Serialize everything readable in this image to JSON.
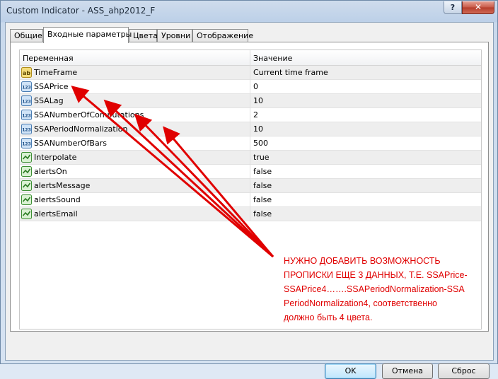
{
  "window": {
    "title": "Custom Indicator - ASS_ahp2012_F",
    "close_label": "✕",
    "help_label": "?"
  },
  "tabs": [
    {
      "label": "Общие",
      "active": false
    },
    {
      "label": "Входные параметры",
      "active": true
    },
    {
      "label": "Цвета",
      "active": false
    },
    {
      "label": "Уровни",
      "active": false
    },
    {
      "label": "Отображение",
      "active": false
    }
  ],
  "grid": {
    "headers": {
      "name": "Переменная",
      "value": "Значение"
    },
    "rows": [
      {
        "icon": "string-icon",
        "name": "TimeFrame",
        "value": "Current time frame"
      },
      {
        "icon": "integer-icon",
        "name": "SSAPrice",
        "value": "0"
      },
      {
        "icon": "integer-icon",
        "name": "SSALag",
        "value": "10"
      },
      {
        "icon": "integer-icon",
        "name": "SSANumberOfComputations",
        "value": "2"
      },
      {
        "icon": "integer-icon",
        "name": "SSAPeriodNormalization",
        "value": "10"
      },
      {
        "icon": "integer-icon",
        "name": "SSANumberOfBars",
        "value": "500"
      },
      {
        "icon": "boolean-icon",
        "name": "Interpolate",
        "value": "true"
      },
      {
        "icon": "boolean-icon",
        "name": "alertsOn",
        "value": "false"
      },
      {
        "icon": "boolean-icon",
        "name": "alertsMessage",
        "value": "false"
      },
      {
        "icon": "boolean-icon",
        "name": "alertsSound",
        "value": "false"
      },
      {
        "icon": "boolean-icon",
        "name": "alertsEmail",
        "value": "false"
      }
    ]
  },
  "annotation": {
    "lines": [
      "НУЖНО ДОБАВИТЬ ВОЗМОЖНОСТЬ",
      "ПРОПИСКИ ЕЩЕ 3 ДАННЫХ, Т.Е. SSAPrice-",
      "SSAPrice4…….SSAPeriodNormalization-SSA",
      "PeriodNormalization4, соответственно",
      "должно быть 4 цвета."
    ],
    "color": "#e00000"
  },
  "buttons": {
    "ok": "OK",
    "cancel": "Отмена",
    "reset": "Сброс"
  }
}
